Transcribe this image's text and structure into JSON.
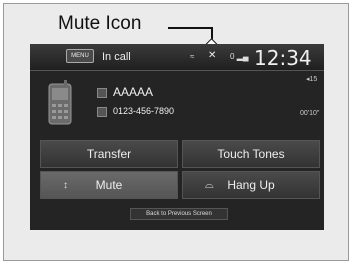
{
  "callout": {
    "label": "Mute Icon"
  },
  "topbar": {
    "menu_label": "MENU",
    "title": "In call",
    "mute_status_icon": "mute-icon",
    "signal_text": "0",
    "clock": "12:34",
    "signal_strength": "15"
  },
  "caller": {
    "name": "AAAAA",
    "number": "0123-456-7890",
    "duration": "00'10\""
  },
  "buttons": {
    "transfer": "Transfer",
    "touch_tones": "Touch Tones",
    "mute": "Mute",
    "hang_up": "Hang Up",
    "back": "Back to Previous Screen"
  },
  "colors": {
    "screen_bg": "#242424",
    "active_button": "#6a6a6a"
  }
}
